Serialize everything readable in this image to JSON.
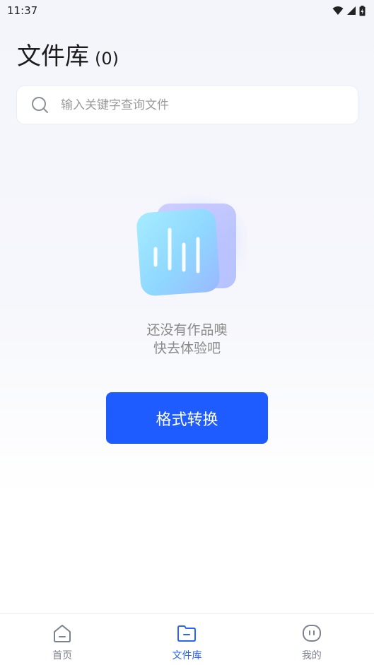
{
  "status_bar": {
    "time": "11:37"
  },
  "header": {
    "title": "文件库",
    "count": "(0)"
  },
  "search": {
    "placeholder": "输入关键字查询文件"
  },
  "empty_state": {
    "line1": "还没有作品噢",
    "line2": "快去体验吧"
  },
  "primary_action": {
    "label": "格式转换"
  },
  "tabbar": {
    "tabs": [
      {
        "label": "首页",
        "icon": "home-icon",
        "active": false
      },
      {
        "label": "文件库",
        "icon": "folder-icon",
        "active": true
      },
      {
        "label": "我的",
        "icon": "profile-icon",
        "active": false
      }
    ]
  },
  "colors": {
    "accent": "#1f5cff",
    "tab_active": "#2b63ff",
    "tab_inactive": "#7d8290"
  }
}
